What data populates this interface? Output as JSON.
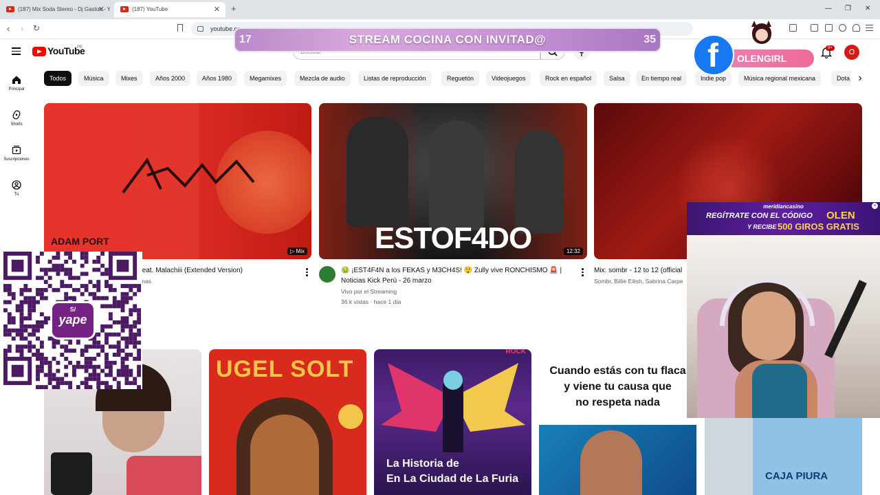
{
  "browser": {
    "tabs": [
      {
        "title": "(187) Mix Soda Stereo - Dj Gaston - Y"
      },
      {
        "title": "(187) YouTube"
      }
    ],
    "new_tab": "+",
    "url": "youtube.com",
    "controls": {
      "minimize": "—",
      "restore": "❐",
      "close": "✕"
    }
  },
  "youtube": {
    "logo_text": "YouTube",
    "region": "PE",
    "search_placeholder": "Buscar",
    "avatar_letter": "O",
    "notifications_badge": "9+",
    "sidebar": [
      {
        "label": "Principal",
        "icon": "home-icon"
      },
      {
        "label": "Shorts",
        "icon": "shorts-icon"
      },
      {
        "label": "Suscripciones",
        "icon": "subscriptions-icon"
      },
      {
        "label": "Tú",
        "icon": "you-icon"
      }
    ],
    "chips": [
      "Todos",
      "Música",
      "Mixes",
      "Años 2000",
      "Años 1980",
      "Megamixes",
      "Mezcla de audio",
      "Listas de reproducción",
      "Reguetón",
      "Videojuegos",
      "Rock en español",
      "Salsa",
      "En tiempo real",
      "Indie pop",
      "Música regional mexicana",
      "Dota"
    ],
    "videos": [
      {
        "title": "feat. Malachiii (Extended Version)",
        "channel": "mas",
        "badge": "Mix",
        "thumb_text": "ADAM PORT"
      },
      {
        "title": "🤢 ¡EST4F4N a los FEKAS y M3CH4S! 😲 Zully vive RONCHISMO 🚨 | Noticias Kick Perú - 26 marzo",
        "channel": "Vivo por el Streaming",
        "stats": "36 k vistas · hace 1 día",
        "duration": "12:32",
        "thumb_text": "ESTOF4DO"
      },
      {
        "title": "Mix: sombr - 12 to 12 (official",
        "channel": "Sombr, Billie Eilish, Sabrina Carpe"
      }
    ],
    "row2": [
      {
        "thumb_text": ""
      },
      {
        "thumb_text": "UGEL SOLT"
      },
      {
        "thumb_text": "La Historia de\nEn La Ciudad de La Furia",
        "top_text": "ROCK"
      },
      {
        "thumb_text": "Cuando estás con tu flaca\ny viene tu causa que\nno respeta nada"
      },
      {
        "thumb_text": "CAJA PIURA"
      }
    ]
  },
  "overlay": {
    "stream_left_num": "17",
    "stream_title": "STREAM COCINA CON INVITAD@",
    "stream_right_num": "35",
    "facebook_letter": "f",
    "facebook_name": "OLENGIRL",
    "casino_brand": "meridiancasino",
    "casino_line1": "REGÍTRATE CON EL CÓDIGO",
    "casino_code": "OLEN",
    "casino_line2": "Y RECIBE",
    "casino_offer": "500 GIROS GRATIS",
    "qr_brand": "yape",
    "qr_symbol": "S/"
  }
}
